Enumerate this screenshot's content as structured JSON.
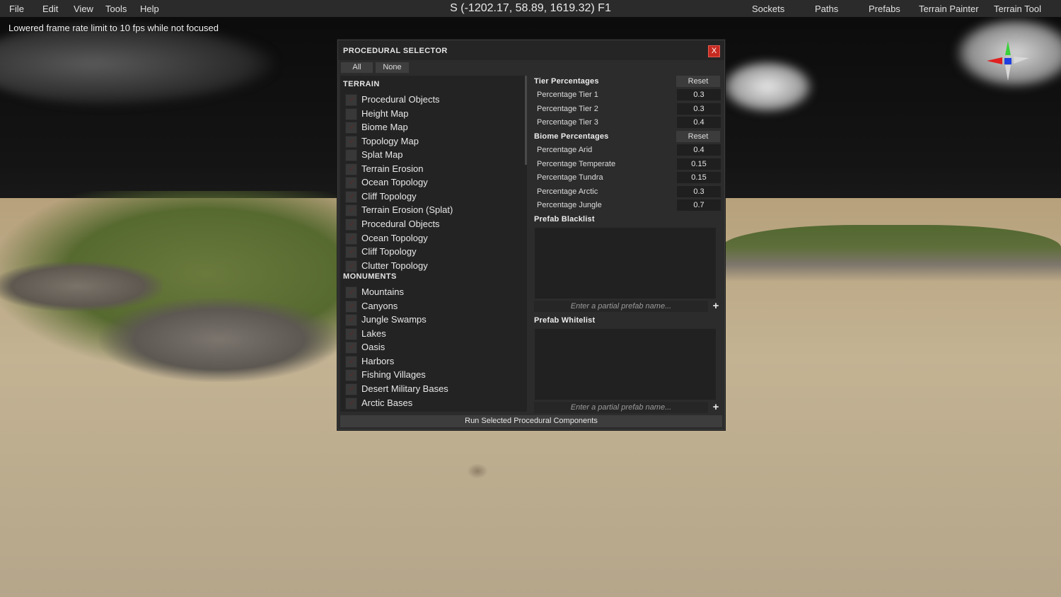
{
  "menubar": {
    "items": [
      "File",
      "Edit",
      "View",
      "Tools",
      "Help"
    ],
    "title": "S (-1202.17, 58.89, 1619.32) F1",
    "right_items": [
      "Sockets",
      "Paths",
      "Prefabs",
      "Terrain Painter",
      "Terrain Tool"
    ]
  },
  "status": {
    "fps_note": "Lowered frame rate limit to 10 fps while not focused"
  },
  "panel": {
    "title": "PROCEDURAL SELECTOR",
    "close_label": "X",
    "select_all_label": "All",
    "select_none_label": "None",
    "sections": [
      {
        "heading": "TERRAIN",
        "items": [
          {
            "label": "Procedural Objects",
            "checked": true
          },
          {
            "label": "Height Map",
            "checked": false
          },
          {
            "label": "Biome Map",
            "checked": true
          },
          {
            "label": "Topology Map",
            "checked": true
          },
          {
            "label": "Splat Map",
            "checked": false
          },
          {
            "label": "Terrain Erosion",
            "checked": true
          },
          {
            "label": "Ocean Topology",
            "checked": true
          },
          {
            "label": "Cliff Topology",
            "checked": true
          },
          {
            "label": "Terrain Erosion (Splat)",
            "checked": true
          },
          {
            "label": "Procedural Objects",
            "checked": true
          },
          {
            "label": "Ocean Topology",
            "checked": true
          },
          {
            "label": "Cliff Topology",
            "checked": true
          },
          {
            "label": "Clutter Topology",
            "checked": true
          }
        ]
      },
      {
        "heading": "MONUMENTS",
        "items": [
          {
            "label": "Mountains",
            "checked": true
          },
          {
            "label": "Canyons",
            "checked": true
          },
          {
            "label": "Jungle Swamps",
            "checked": true
          },
          {
            "label": "Lakes",
            "checked": true
          },
          {
            "label": "Oasis",
            "checked": true
          },
          {
            "label": "Harbors",
            "checked": true
          },
          {
            "label": "Fishing Villages",
            "checked": true
          },
          {
            "label": "Desert Military Bases",
            "checked": true
          },
          {
            "label": "Arctic Bases",
            "checked": true
          }
        ]
      }
    ],
    "tier": {
      "heading": "Tier Percentages",
      "reset_label": "Reset",
      "rows": [
        {
          "label": "Percentage Tier 1",
          "value": "0.3"
        },
        {
          "label": "Percentage Tier 2",
          "value": "0.3"
        },
        {
          "label": "Percentage Tier 3",
          "value": "0.4"
        }
      ]
    },
    "biome": {
      "heading": "Biome Percentages",
      "reset_label": "Reset",
      "rows": [
        {
          "label": "Percentage Arid",
          "value": "0.4"
        },
        {
          "label": "Percentage Temperate",
          "value": "0.15"
        },
        {
          "label": "Percentage Tundra",
          "value": "0.15"
        },
        {
          "label": "Percentage Arctic",
          "value": "0.3"
        },
        {
          "label": "Percentage Jungle",
          "value": "0.7"
        }
      ]
    },
    "blacklist": {
      "heading": "Prefab Blacklist",
      "placeholder": "Enter a partial prefab name...",
      "add_label": "+"
    },
    "whitelist": {
      "heading": "Prefab Whitelist",
      "placeholder": "Enter a partial prefab name...",
      "add_label": "+"
    },
    "run_label": "Run Selected Procedural Components"
  },
  "colors": {
    "close": "#c62a20",
    "panel_bg": "#2c2c2c",
    "list_bg": "#232323"
  }
}
